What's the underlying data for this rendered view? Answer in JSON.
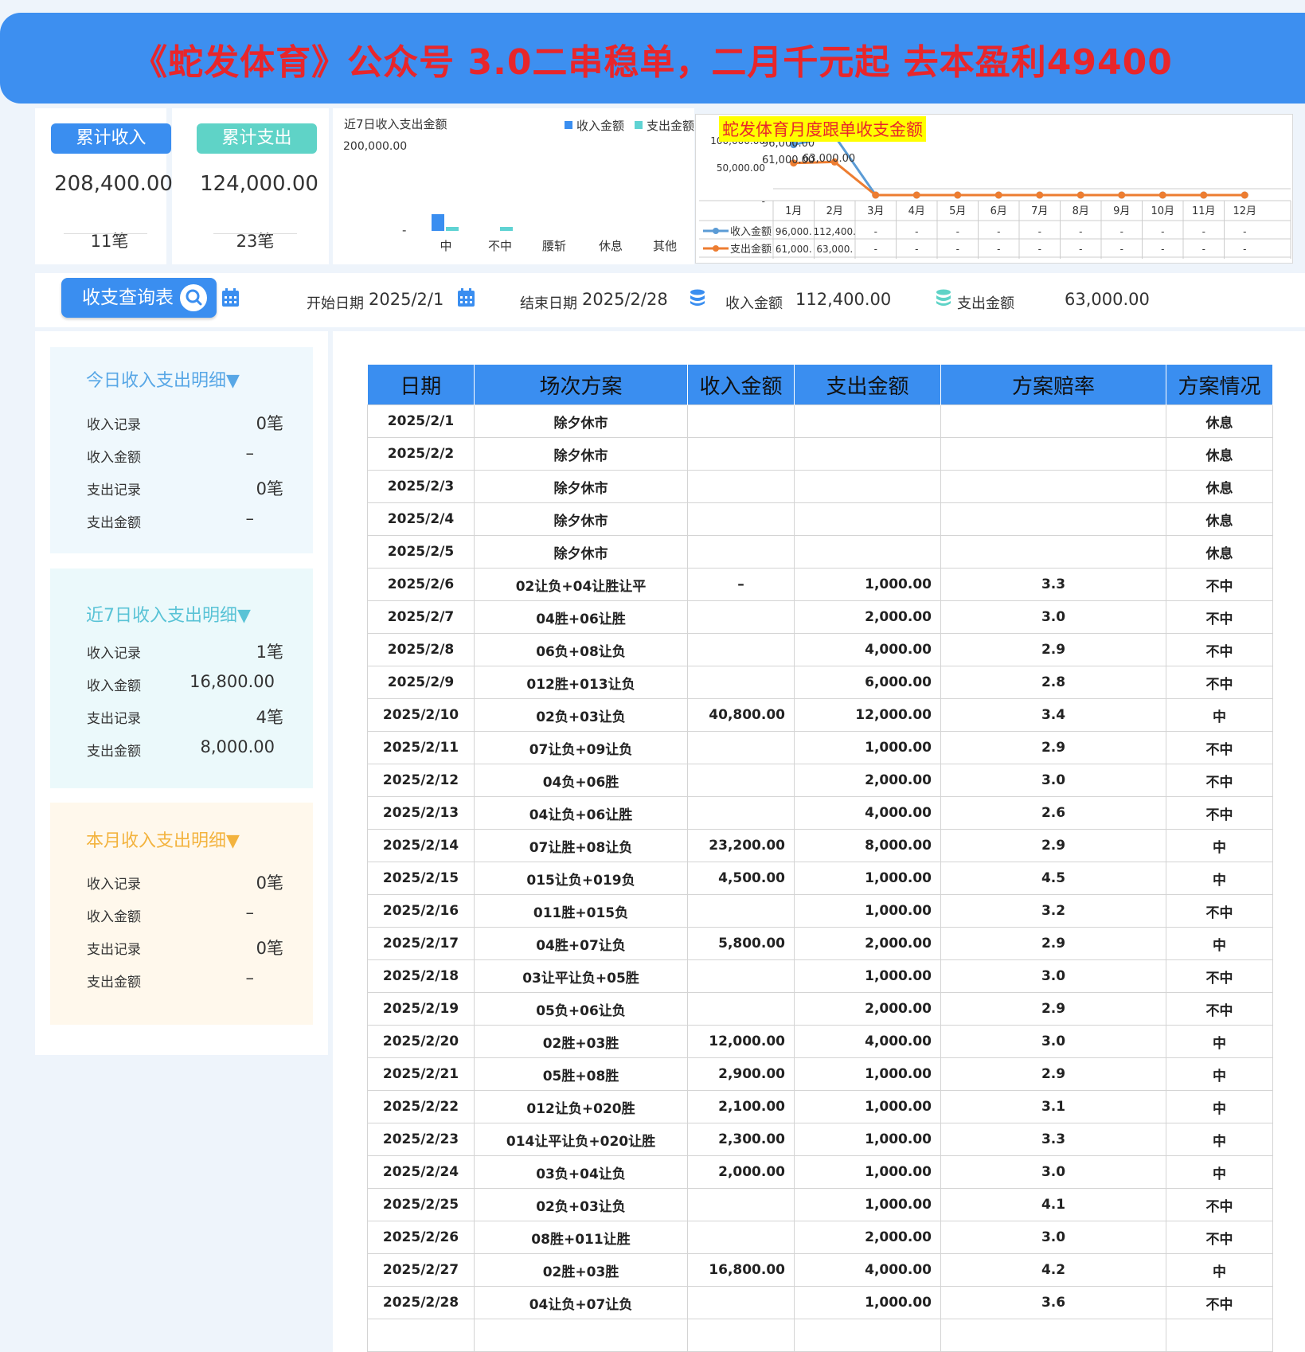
{
  "banner": {
    "title": "《蛇发体育》公众号 3.0二串稳单，二月千元起 去本盈利49400"
  },
  "summary": {
    "income_label": "累计收入",
    "expense_label": "累计支出",
    "income_total": "208,400.00",
    "expense_total": "124,000.00",
    "income_count": "11笔",
    "expense_count": "23笔"
  },
  "week_chart": {
    "title": "近7日收入支出金额",
    "y_tick": "200,000.00",
    "y_zero": "-",
    "legend_income": "收入金额",
    "legend_expense": "支出金额",
    "chart_data": {
      "type": "bar",
      "categories": [
        "中",
        "不中",
        "腰斩",
        "休息",
        "其他"
      ],
      "series": [
        {
          "name": "收入金额",
          "values": [
            16800,
            0,
            0,
            0,
            0
          ]
        },
        {
          "name": "支出金额",
          "values": [
            4000,
            4000,
            0,
            0,
            0
          ]
        }
      ],
      "colors": {
        "收入金额": "#3a8ef0",
        "支出金额": "#5fd3d3"
      }
    }
  },
  "month_chart": {
    "title": "蛇发体育月度跟单收支金额",
    "y_ticks": [
      "100,000.00",
      "50,000.00",
      "-"
    ],
    "months": [
      "1月",
      "2月",
      "3月",
      "4月",
      "5月",
      "6月",
      "7月",
      "8月",
      "9月",
      "10月",
      "11月",
      "12月"
    ],
    "row_income_label": "收入金额",
    "row_expense_label": "支出金额",
    "row_income": [
      "96,000.",
      "112,400.",
      "-",
      "-",
      "-",
      "-",
      "-",
      "-",
      "-",
      "-",
      "-",
      "-"
    ],
    "row_expense": [
      "61,000.",
      "63,000.",
      "-",
      "-",
      "-",
      "-",
      "-",
      "-",
      "-",
      "-",
      "-",
      "-"
    ],
    "label_jan_income": "96,000.00",
    "label_feb_income": "112,400.00",
    "label_jan_expense": "61,000.00",
    "label_feb_expense": "63,000.00",
    "chart_data": {
      "type": "line",
      "x": [
        "1月",
        "2月",
        "3月",
        "4月",
        "5月",
        "6月",
        "7月",
        "8月",
        "9月",
        "10月",
        "11月",
        "12月"
      ],
      "series": [
        {
          "name": "收入金额",
          "values": [
            96000,
            112400,
            0,
            0,
            0,
            0,
            0,
            0,
            0,
            0,
            0,
            0
          ],
          "color": "#5b9bd5"
        },
        {
          "name": "支出金额",
          "values": [
            61000,
            63000,
            0,
            0,
            0,
            0,
            0,
            0,
            0,
            0,
            0,
            0
          ],
          "color": "#ed7d31"
        }
      ],
      "ylim": [
        0,
        120000
      ]
    }
  },
  "query": {
    "button_label": "收支查询表",
    "start_label": "开始日期",
    "start_value": "2025/2/1",
    "end_label": "结束日期",
    "end_value": "2025/2/28",
    "income_label": "收入金额",
    "income_value": "112,400.00",
    "expense_label": "支出金额",
    "expense_value": "63,000.00"
  },
  "today": {
    "title": "今日收入支出明细▼",
    "rows": [
      {
        "label": "收入记录",
        "value": "0笔"
      },
      {
        "label": "收入金额",
        "value": "–"
      },
      {
        "label": "支出记录",
        "value": "0笔"
      },
      {
        "label": "支出金额",
        "value": "–"
      }
    ]
  },
  "week": {
    "title": "近7日收入支出明细▼",
    "rows": [
      {
        "label": "收入记录",
        "value": "1笔"
      },
      {
        "label": "收入金额",
        "value": "16,800.00"
      },
      {
        "label": "支出记录",
        "value": "4笔"
      },
      {
        "label": "支出金额",
        "value": "8,000.00"
      }
    ]
  },
  "month": {
    "title": "本月收入支出明细▼",
    "rows": [
      {
        "label": "收入记录",
        "value": "0笔"
      },
      {
        "label": "收入金额",
        "value": "–"
      },
      {
        "label": "支出记录",
        "value": "0笔"
      },
      {
        "label": "支出金额",
        "value": "–"
      }
    ]
  },
  "table": {
    "headers": [
      "日期",
      "场次方案",
      "收入金额",
      "支出金额",
      "方案赔率",
      "方案情况"
    ],
    "rows": [
      [
        "2025/2/1",
        "除夕休市",
        "",
        "",
        "",
        "休息"
      ],
      [
        "2025/2/2",
        "除夕休市",
        "",
        "",
        "",
        "休息"
      ],
      [
        "2025/2/3",
        "除夕休市",
        "",
        "",
        "",
        "休息"
      ],
      [
        "2025/2/4",
        "除夕休市",
        "",
        "",
        "",
        "休息"
      ],
      [
        "2025/2/5",
        "除夕休市",
        "",
        "",
        "",
        "休息"
      ],
      [
        "2025/2/6",
        "02让负+04让胜让平",
        "–",
        "1,000.00",
        "3.3",
        "不中"
      ],
      [
        "2025/2/7",
        "04胜+06让胜",
        "",
        "2,000.00",
        "3.0",
        "不中"
      ],
      [
        "2025/2/8",
        "06负+08让负",
        "",
        "4,000.00",
        "2.9",
        "不中"
      ],
      [
        "2025/2/9",
        "012胜+013让负",
        "",
        "6,000.00",
        "2.8",
        "不中"
      ],
      [
        "2025/2/10",
        "02负+03让负",
        "40,800.00",
        "12,000.00",
        "3.4",
        "中"
      ],
      [
        "2025/2/11",
        "07让负+09让负",
        "",
        "1,000.00",
        "2.9",
        "不中"
      ],
      [
        "2025/2/12",
        "04负+06胜",
        "",
        "2,000.00",
        "3.0",
        "不中"
      ],
      [
        "2025/2/13",
        "04让负+06让胜",
        "",
        "4,000.00",
        "2.6",
        "不中"
      ],
      [
        "2025/2/14",
        "07让胜+08让负",
        "23,200.00",
        "8,000.00",
        "2.9",
        "中"
      ],
      [
        "2025/2/15",
        "015让负+019负",
        "4,500.00",
        "1,000.00",
        "4.5",
        "中"
      ],
      [
        "2025/2/16",
        "011胜+015负",
        "",
        "1,000.00",
        "3.2",
        "不中"
      ],
      [
        "2025/2/17",
        "04胜+07让负",
        "5,800.00",
        "2,000.00",
        "2.9",
        "中"
      ],
      [
        "2025/2/18",
        "03让平让负+05胜",
        "",
        "1,000.00",
        "3.0",
        "不中"
      ],
      [
        "2025/2/19",
        "05负+06让负",
        "",
        "2,000.00",
        "2.9",
        "不中"
      ],
      [
        "2025/2/20",
        "02胜+03胜",
        "12,000.00",
        "4,000.00",
        "3.0",
        "中"
      ],
      [
        "2025/2/21",
        "05胜+08胜",
        "2,900.00",
        "1,000.00",
        "2.9",
        "中"
      ],
      [
        "2025/2/22",
        "012让负+020胜",
        "2,100.00",
        "1,000.00",
        "3.1",
        "中"
      ],
      [
        "2025/2/23",
        "014让平让负+020让胜",
        "2,300.00",
        "1,000.00",
        "3.3",
        "中"
      ],
      [
        "2025/2/24",
        "03负+04让负",
        "2,000.00",
        "1,000.00",
        "3.0",
        "中"
      ],
      [
        "2025/2/25",
        "02负+03让负",
        "",
        "1,000.00",
        "4.1",
        "不中"
      ],
      [
        "2025/2/26",
        "08胜+011让胜",
        "",
        "2,000.00",
        "3.0",
        "不中"
      ],
      [
        "2025/2/27",
        "02胜+03胜",
        "16,800.00",
        "4,000.00",
        "4.2",
        "中"
      ],
      [
        "2025/2/28",
        "04让负+07让负",
        "",
        "1,000.00",
        "3.6",
        "不中"
      ]
    ]
  }
}
